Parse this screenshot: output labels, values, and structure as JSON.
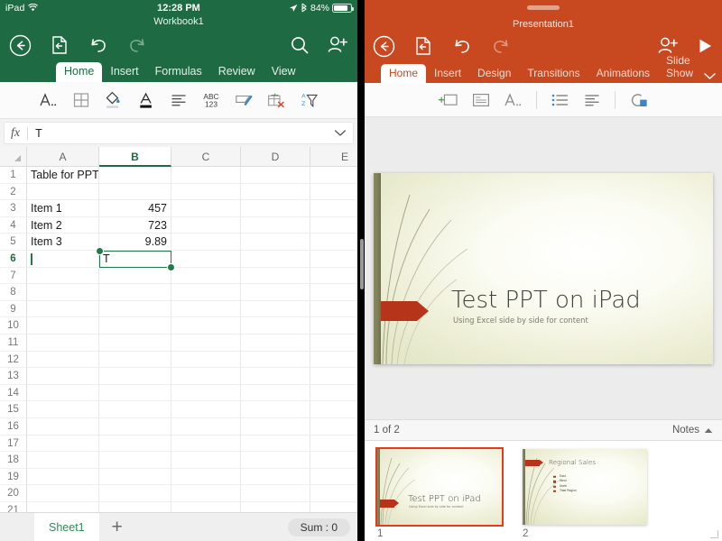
{
  "theme": {
    "excel_green": "#1e6b43",
    "excel_accent": "#217a47",
    "ppt_orange": "#c8481f",
    "ppt_thumb_select": "#e8391b",
    "slide_arrow_red": "#b5341a",
    "slide_bar_olive": "#7e7e57"
  },
  "ios_status": {
    "device": "iPad",
    "wifi_icon": "wifi-icon",
    "time": "12:28 PM",
    "location_icon": "location-arrow-icon",
    "bluetooth_icon": "bluetooth-icon",
    "battery_percent": "84%",
    "battery_icon": "battery-icon",
    "battery_level": 84
  },
  "excel": {
    "doc_title": "Workbook1",
    "commands": [
      {
        "name": "back-button",
        "icon": "back-arrow-circle-icon"
      },
      {
        "name": "open-file-button",
        "icon": "file-open-icon"
      },
      {
        "name": "undo-button",
        "icon": "undo-arrow-icon"
      },
      {
        "name": "redo-button",
        "icon": "redo-arrow-icon"
      }
    ],
    "commands_right": [
      {
        "name": "search-button",
        "icon": "search-icon"
      },
      {
        "name": "share-add-person-button",
        "icon": "person-add-icon"
      }
    ],
    "tabs": [
      {
        "label": "Home",
        "active": true
      },
      {
        "label": "Insert",
        "active": false
      },
      {
        "label": "Formulas",
        "active": false
      },
      {
        "label": "Review",
        "active": false
      },
      {
        "label": "View",
        "active": false
      }
    ],
    "ribbon_icons": [
      "font-format-icon",
      "borders-icon",
      "fill-color-icon",
      "font-color-icon",
      "align-left-icon",
      "number-format-abc123-icon",
      "cell-styles-brush-icon",
      "clear-cells-icon",
      "sort-filter-icon"
    ],
    "formula_bar": {
      "fx_label": "fx",
      "value": "T",
      "placeholder": "",
      "expand_icon": "chevron-down-icon"
    },
    "columns": [
      "A",
      "B",
      "C",
      "D",
      "E"
    ],
    "selected_column": "B",
    "selected_row": 6,
    "row_count": 21,
    "cells": {
      "A1": "Table for PPT",
      "A3": "Item 1",
      "B3": "457",
      "A4": "Item 2",
      "B4": "723",
      "A5": "Item 3",
      "B5": "9.89",
      "B6": "T"
    },
    "active_cell_text": "T",
    "sheet_tab": "Sheet1",
    "add_sheet_label": "+",
    "status_summary": "Sum : 0"
  },
  "powerpoint": {
    "doc_title": "Presentation1",
    "grabber": "drag-handle",
    "commands": [
      {
        "name": "back-button",
        "icon": "back-arrow-circle-icon"
      },
      {
        "name": "open-file-button",
        "icon": "file-open-icon"
      },
      {
        "name": "undo-button",
        "icon": "undo-arrow-icon"
      },
      {
        "name": "redo-button",
        "icon": "redo-arrow-icon"
      }
    ],
    "commands_right": [
      {
        "name": "share-add-person-button",
        "icon": "person-add-icon"
      },
      {
        "name": "present-play-button",
        "icon": "play-triangle-icon"
      }
    ],
    "tabs": [
      {
        "label": "Home",
        "active": true
      },
      {
        "label": "Insert",
        "active": false
      },
      {
        "label": "Design",
        "active": false
      },
      {
        "label": "Transitions",
        "active": false
      },
      {
        "label": "Animations",
        "active": false
      },
      {
        "label": "Slide Show",
        "active": false
      }
    ],
    "ribbon_collapse_icon": "chevron-down-icon",
    "ribbon_icons": [
      "new-slide-icon",
      "layout-icon",
      "font-format-icon",
      "bullet-list-icon",
      "align-left-icon",
      "shape-format-icon"
    ],
    "slide_counter": "1 of 2",
    "notes_label": "Notes",
    "notes_toggle_icon": "caret-up-icon",
    "resize_corner_icon": "resize-handle-icon",
    "slides": [
      {
        "number": "1",
        "selected": true,
        "title": "Test PPT on iPad",
        "subtitle": "Using Excel side by side for content",
        "bullets": []
      },
      {
        "number": "2",
        "selected": false,
        "title": "Regional Sales",
        "subtitle": "",
        "bullets": [
          "East",
          "West",
          "North",
          "Total Region"
        ]
      }
    ],
    "current_slide_index": 0
  }
}
